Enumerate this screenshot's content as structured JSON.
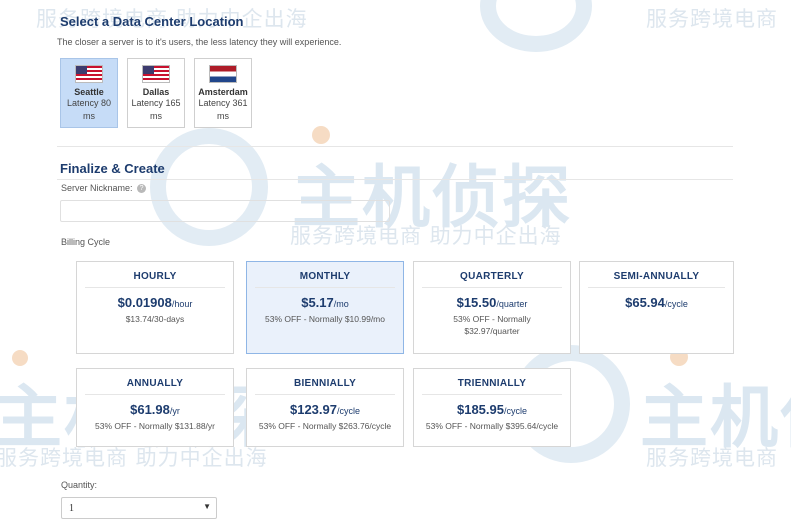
{
  "watermark": {
    "small_text": "服务跨境电商",
    "slogan_text": "服务跨境电商 助力中企出海",
    "brand_text": "主机侦探"
  },
  "location": {
    "title": "Select a Data Center Location",
    "subtitle": "The closer a server is to it's users, the less latency they will experience.",
    "items": [
      {
        "name": "Seattle",
        "latency": "Latency 80 ms",
        "flag": "us-flag-icon",
        "selected": true
      },
      {
        "name": "Dallas",
        "latency": "Latency 165 ms",
        "flag": "us-flag-icon",
        "selected": false
      },
      {
        "name": "Amsterdam",
        "latency": "Latency 361 ms",
        "flag": "nl-flag-icon",
        "selected": false
      }
    ]
  },
  "finalize": {
    "title": "Finalize & Create",
    "nickname_label": "Server Nickname:",
    "nickname_value": "",
    "help_glyph": "?",
    "billing_label": "Billing Cycle"
  },
  "billing": {
    "plans": [
      {
        "name": "HOURLY",
        "price": "$0.01908",
        "per": "/hour",
        "note1": "$13.74/30-days",
        "note2": "",
        "selected": false
      },
      {
        "name": "MONTHLY",
        "price": "$5.17",
        "per": "/mo",
        "note1": "53% OFF - Normally $10.99/mo",
        "note2": "",
        "selected": true
      },
      {
        "name": "QUARTERLY",
        "price": "$15.50",
        "per": "/quarter",
        "note1": "53% OFF - Normally",
        "note2": "$32.97/quarter",
        "selected": false
      },
      {
        "name": "SEMI-ANNUALLY",
        "price": "$65.94",
        "per": "/cycle",
        "note1": "",
        "note2": "",
        "selected": false
      },
      {
        "name": "ANNUALLY",
        "price": "$61.98",
        "per": "/yr",
        "note1": "53% OFF - Normally $131.88/yr",
        "note2": "",
        "selected": false
      },
      {
        "name": "BIENNIALLY",
        "price": "$123.97",
        "per": "/cycle",
        "note1": "53% OFF - Normally $263.76/cycle",
        "note2": "",
        "selected": false
      },
      {
        "name": "TRIENNIALLY",
        "price": "$185.95",
        "per": "/cycle",
        "note1": "53% OFF - Normally $395.64/cycle",
        "note2": "",
        "selected": false
      }
    ]
  },
  "quantity": {
    "label": "Quantity:",
    "value": "1",
    "chevron": "▼"
  },
  "colors": {
    "heading": "#1d3c6e",
    "selected_location_bg": "#c6dcf7",
    "selected_plan_bg": "#eaf1fb",
    "selected_plan_border": "#8fb6e6"
  }
}
